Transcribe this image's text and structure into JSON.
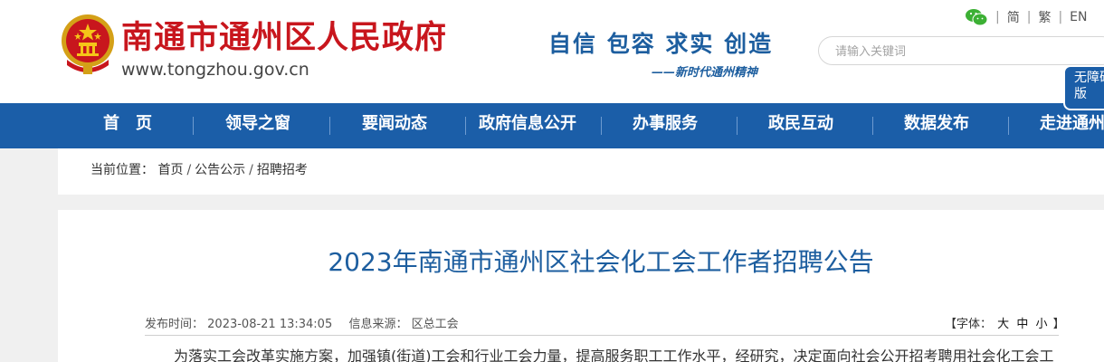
{
  "header": {
    "site_name": "南通市通州区人民政府",
    "site_url": "www.tongzhou.gov.cn",
    "slogan": "自信 包容 求实 创造",
    "slogan_sub": "——新时代通州精神",
    "toplinks": [
      "简",
      "繁",
      "EN"
    ],
    "search_placeholder": "请输入关键词",
    "accessibility_label": "无障碍版",
    "colors": {
      "brand_red": "#c8161d",
      "nav_blue": "#1b5ea8",
      "title_blue": "#1d5e9f"
    }
  },
  "nav": {
    "items": [
      "首　页",
      "领导之窗",
      "要闻动态",
      "政府信息公开",
      "办事服务",
      "政民互动",
      "数据发布",
      "走进通州"
    ]
  },
  "breadcrumb": {
    "label": "当前位置：",
    "items": [
      "首页",
      "公告公示",
      "招聘招考"
    ]
  },
  "article": {
    "title": "2023年南通市通州区社会化工会工作者招聘公告",
    "publish_label": "发布时间：",
    "publish_time": "2023-08-21 13:34:05",
    "source_label": "信息来源：",
    "source": "区总工会",
    "font_label_open": "【字体：",
    "font_sizes": [
      "大",
      "中",
      "小"
    ],
    "font_label_close": "】",
    "first_line": "为落实工会改革实施方案，加强镇(街道)工会和行业工会力量，提高服务职工工作水平，经研究，决定面向社会公开招考聘用社会化工会工"
  }
}
